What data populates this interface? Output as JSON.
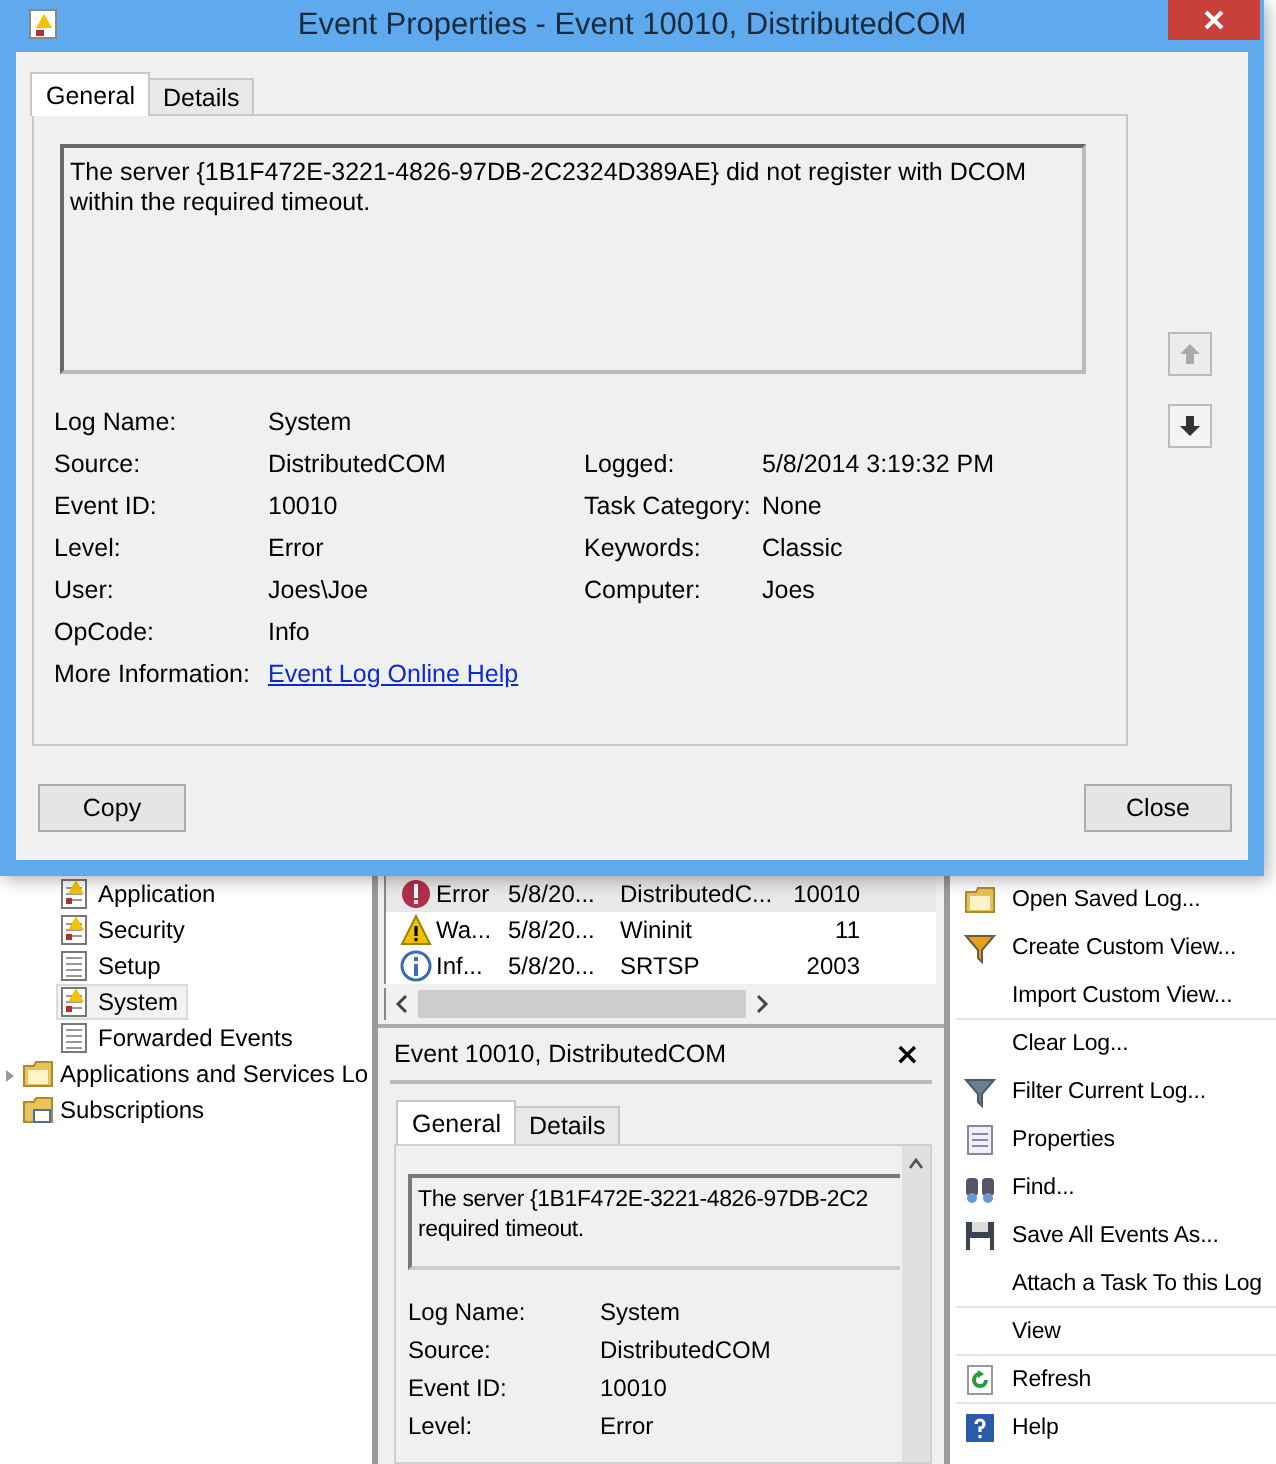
{
  "dialog": {
    "title": "Event Properties - Event 10010, DistributedCOM",
    "tabs": [
      {
        "label": "General",
        "selected": true
      },
      {
        "label": "Details",
        "selected": false
      }
    ],
    "message": "The server {1B1F472E-3221-4826-97DB-2C2324D389AE} did not register with DCOM within the required timeout.",
    "rows": [
      {
        "left": {
          "label": "Log Name:",
          "value": "System"
        }
      },
      {
        "left": {
          "label": "Source:",
          "value": "DistributedCOM"
        },
        "right": {
          "label": "Logged:",
          "value": "5/8/2014 3:19:32 PM"
        }
      },
      {
        "left": {
          "label": "Event ID:",
          "value": "10010"
        },
        "right": {
          "label": "Task Category:",
          "value": "None"
        }
      },
      {
        "left": {
          "label": "Level:",
          "value": "Error"
        },
        "right": {
          "label": "Keywords:",
          "value": "Classic"
        }
      },
      {
        "left": {
          "label": "User:",
          "value": "Joes\\Joe"
        },
        "right": {
          "label": "Computer:",
          "value": "Joes"
        }
      },
      {
        "left": {
          "label": "OpCode:",
          "value": "Info"
        }
      }
    ],
    "more_information": {
      "label": "More Information:",
      "link": "Event Log Online Help"
    },
    "buttons": [
      "Copy",
      "Close"
    ]
  },
  "tree": {
    "log_items": [
      {
        "label": "Application",
        "kind": "warninglog",
        "selected": false
      },
      {
        "label": "Security",
        "kind": "warninglog",
        "selected": false
      },
      {
        "label": "Setup",
        "kind": "log",
        "selected": false
      },
      {
        "label": "System",
        "kind": "warninglog",
        "selected": true
      },
      {
        "label": "Forwarded Events",
        "kind": "log",
        "selected": false
      }
    ],
    "items": [
      {
        "label": "Applications and Services Lo",
        "kind": "folder",
        "expanded": false
      },
      {
        "label": "Subscriptions",
        "kind": "subscriptions"
      }
    ]
  },
  "event_list": {
    "rows": [
      {
        "kind": "error",
        "level": "Error",
        "date": "5/8/20...",
        "source": "DistributedC...",
        "event_id": "10010",
        "selected": true
      },
      {
        "kind": "warning",
        "level": "Wa...",
        "date": "5/8/20...",
        "source": "Wininit",
        "event_id": "11",
        "selected": false
      },
      {
        "kind": "info",
        "level": "Inf...",
        "date": "5/8/20...",
        "source": "SRTSP",
        "event_id": "2003",
        "selected": false
      }
    ]
  },
  "preview": {
    "title": "Event 10010, DistributedCOM",
    "close": "×",
    "tabs": [
      {
        "label": "General",
        "selected": true
      },
      {
        "label": "Details",
        "selected": false
      }
    ],
    "message_lines": [
      "The server {1B1F472E-3221-4826-97DB-2C2",
      "required timeout."
    ],
    "fields": [
      {
        "label": "Log Name:",
        "value": "System"
      },
      {
        "label": "Source:",
        "value": "DistributedCOM"
      },
      {
        "label": "Event ID:",
        "value": "10010"
      },
      {
        "label": "Level:",
        "value": "Error"
      }
    ]
  },
  "actions": [
    {
      "label": "Open Saved Log...",
      "kind": "folder",
      "divider_after": false
    },
    {
      "label": "Create Custom View...",
      "kind": "colorfunnel",
      "divider_after": false
    },
    {
      "label": "Import Custom View...",
      "kind": "plain",
      "divider_after": true
    },
    {
      "label": "Clear Log...",
      "kind": "plain",
      "divider_after": false
    },
    {
      "label": "Filter Current Log...",
      "kind": "funnel",
      "divider_after": false
    },
    {
      "label": "Properties",
      "kind": "properties",
      "divider_after": false
    },
    {
      "label": "Find...",
      "kind": "binoculars",
      "divider_after": false
    },
    {
      "label": "Save All Events As...",
      "kind": "floppy",
      "divider_after": false
    },
    {
      "label": "Attach a Task To this Log",
      "kind": "plain",
      "divider_after": true
    },
    {
      "label": "View",
      "kind": "plain",
      "divider_after": true
    },
    {
      "label": "Refresh",
      "kind": "refresh",
      "divider_after": true
    },
    {
      "label": "Help",
      "kind": "help",
      "divider_after": false
    }
  ]
}
